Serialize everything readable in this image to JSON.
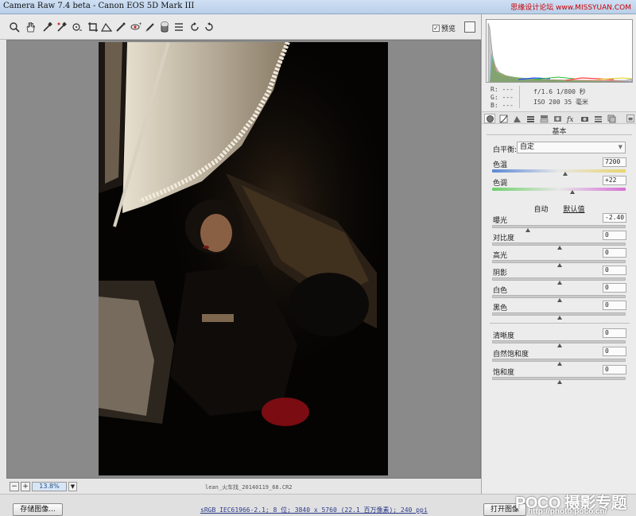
{
  "app": {
    "title": "Camera Raw 7.4 beta -  Canon EOS 5D Mark III",
    "watermark": "思缘设计论坛 www.MISSYUAN.COM"
  },
  "toolbar": {
    "tools": [
      "zoom-icon",
      "hand-icon",
      "white-balance-icon",
      "color-sampler-icon",
      "target-adjust-icon",
      "crop-icon",
      "straighten-icon",
      "spot-removal-icon",
      "red-eye-icon",
      "adjustment-brush-icon",
      "graduated-filter-icon",
      "radial-filter-icon",
      "preferences-icon",
      "rotate-ccw-icon",
      "rotate-cw-icon"
    ],
    "preview_label": "预览",
    "preview_checked": true
  },
  "canvas": {
    "zoom": "13.8%",
    "filename": "lean_火车找_20140119_68.CR2"
  },
  "footer": {
    "save_label": "存储图像...",
    "workflow": "sRGB IEC61966-2.1; 8 位; 3840 x 5760 (22.1 百万像素); 240 ppi",
    "open_label": "打开图像",
    "logo": "POCO 摄影专题",
    "logo_url": "http://photo.poco.cn/"
  },
  "info": {
    "r": "R:  ---",
    "g": "G:  ---",
    "b": "B:  ---",
    "exposure": "f/1.6   1/800 秒",
    "iso": "ISO 200   35 毫米"
  },
  "panel": {
    "tabs": [
      "basic-icon",
      "tone-curve-icon",
      "detail-icon",
      "hsl-icon",
      "split-toning-icon",
      "lens-icon",
      "fx-icon",
      "camera-calibration-icon",
      "presets-icon",
      "snapshots-icon"
    ],
    "section_title": "基本",
    "white_balance_label": "白平衡:",
    "white_balance_value": "自定",
    "temperature_label": "色温",
    "temperature_value": "7200",
    "tint_label": "色调",
    "tint_value": "+22",
    "auto_label": "自动",
    "default_label": "默认值",
    "exposure_label": "曝光",
    "exposure_value": "-2.40",
    "contrast_label": "对比度",
    "contrast_value": "0",
    "highlights_label": "高光",
    "highlights_value": "0",
    "shadows_label": "阴影",
    "shadows_value": "0",
    "whites_label": "白色",
    "whites_value": "0",
    "blacks_label": "黑色",
    "blacks_value": "0",
    "clarity_label": "清晰度",
    "clarity_value": "0",
    "vibrance_label": "自然饱和度",
    "vibrance_value": "0",
    "saturation_label": "饱和度",
    "saturation_value": "0"
  },
  "sliders": {
    "temperature": 0.55,
    "tint": 0.6,
    "exposure": 0.26,
    "contrast": 0.5,
    "highlights": 0.5,
    "shadows": 0.5,
    "whites": 0.5,
    "blacks": 0.5,
    "clarity": 0.5,
    "vibrance": 0.5,
    "saturation": 0.5
  }
}
